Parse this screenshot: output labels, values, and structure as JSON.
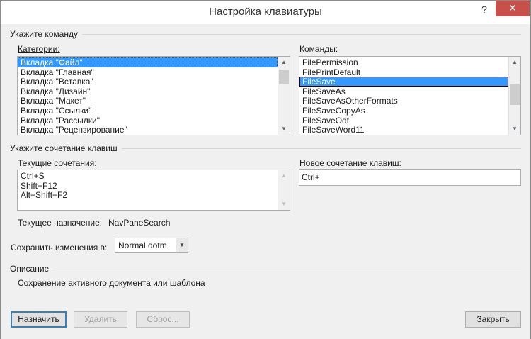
{
  "window": {
    "title": "Настройка клавиатуры",
    "help_glyph": "?",
    "close_glyph": "✕"
  },
  "command_section": {
    "header": "Укажите команду",
    "categories_label": "Категории:",
    "categories": [
      "Вкладка \"Файл\"",
      "Вкладка \"Главная\"",
      "Вкладка \"Вставка\"",
      "Вкладка \"Дизайн\"",
      "Вкладка \"Макет\"",
      "Вкладка \"Ссылки\"",
      "Вкладка \"Рассылки\"",
      "Вкладка \"Рецензирование\""
    ],
    "categories_selected_index": 0,
    "commands_label": "Команды:",
    "commands": [
      "FilePermission",
      "FilePrintDefault",
      "FileSave",
      "FileSaveAs",
      "FileSaveAsOtherFormats",
      "FileSaveCopyAs",
      "FileSaveOdt",
      "FileSaveWord11"
    ],
    "commands_selected_index": 2
  },
  "shortcut_section": {
    "header": "Укажите сочетание клавиш",
    "current_label": "Текущие сочетания:",
    "current_keys": [
      "Ctrl+S",
      "Shift+F12",
      "Alt+Shift+F2"
    ],
    "new_label": "Новое сочетание клавиш:",
    "new_value": "Ctrl+",
    "assigned_label": "Текущее назначение:",
    "assigned_value": "NavPaneSearch",
    "save_in_label": "Сохранить изменения в:",
    "save_in_value": "Normal.dotm"
  },
  "description_section": {
    "header": "Описание",
    "text": "Сохранение активного документа или шаблона"
  },
  "buttons": {
    "assign": "Назначить",
    "remove": "Удалить",
    "reset": "Сброс...",
    "close": "Закрыть"
  },
  "icons": {
    "dropdown": "chevron-down-icon",
    "scroll_up": "scroll-up-arrow-icon",
    "scroll_down": "scroll-down-arrow-icon"
  },
  "colors": {
    "selection": "#3399ff",
    "close_button": "#c7504b",
    "default_button_border": "#3c7fb1"
  }
}
